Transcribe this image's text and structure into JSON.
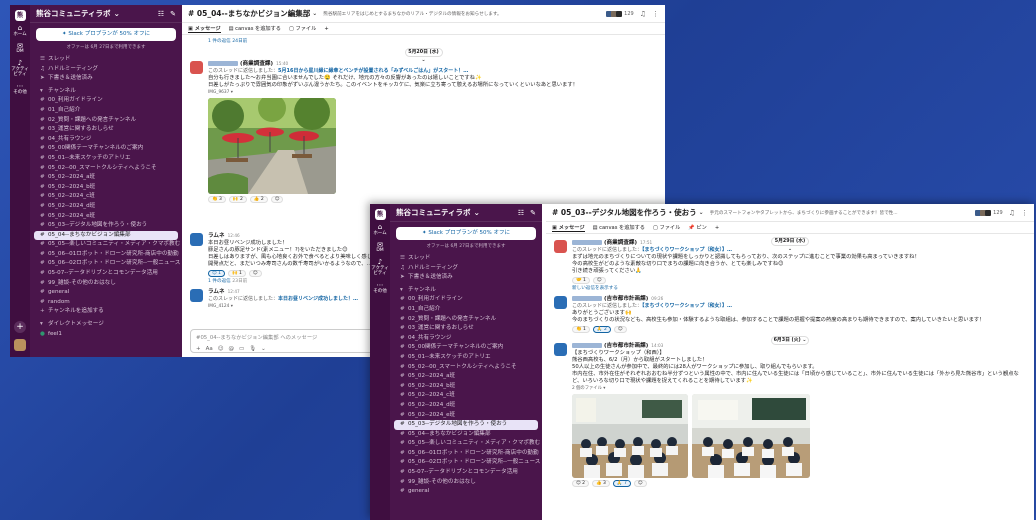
{
  "win1": {
    "rail": {
      "items": [
        {
          "icon": "home-icon",
          "label": "ホーム"
        },
        {
          "icon": "dm-icon",
          "label": "DM"
        },
        {
          "icon": "bell-icon",
          "label": "アクティビティ"
        },
        {
          "icon": "more-icon",
          "label": "その他"
        }
      ]
    },
    "sidebar": {
      "workspace": "熊谷コミュニティラボ",
      "promo": "✦ Slack プロプランが 50% オフに",
      "promo_note": "オファーは 6月 27日まで利用できます",
      "top_items": [
        "スレッド",
        "ハドルミーティング",
        "下書き＆送信済み"
      ],
      "section": "チャンネル",
      "channels": [
        "00_利用ガイドライン",
        "01_自己紹介",
        "02_質問・課題への発言チャンネル",
        "03_運営に関するおしらせ",
        "04_共有ラウンジ",
        "05_00関係テーマチャンネルのご案内",
        "05_01--未来スケッチのアトリエ",
        "05_02--00_スマートクルシティへようこそ",
        "05_02--2024_a班",
        "05_02--2024_b班",
        "05_02--2024_c班",
        "05_02--2024_d班",
        "05_02--2024_e班",
        "05_03--デジタル地図を作ろう・使おう",
        "05_04--まちなかビジョン編集部",
        "05_05--楽しいコミュニティ・メディア・クマポ教む",
        "05_06--01ロボット・ドローン研究所-商店中の勤勤",
        "05_06--02ロボット・ドローン研究所--一般ニュース",
        "05-07--データドリブンとコモンデータ活用",
        "99_雑談-その他のおはなし",
        "general",
        "random"
      ],
      "selected": "05_04--まちなかビジョン編集部",
      "add_channel": "チャンネルを追加する",
      "dm_section": "ダイレクトメッセージ",
      "dm_first": "feel1"
    },
    "header": {
      "title": "# 05_04--まちなかビジョン編集部",
      "topic": "熊谷駅前エリアをはじめとするまちなかのリアル・デジタルの情報をお知らせします。",
      "member_count": "129"
    },
    "tabs": [
      "メッセージ",
      "canvas を追加する",
      "ファイル",
      "+"
    ],
    "top_reply": "1 件の返信 24日前",
    "date_pill": "5月20日 (水) ⌄",
    "msg1": {
      "name": "(商業調査課)",
      "time": "15:40",
      "reply_prefix": "このスレッドに返信しました：",
      "reply_link": "5月16日から星川縁に縁傘とベンチが設置される「みずべルごはん」がスタート！…",
      "lines": [
        "自分も行きました〜お弁当園に合いませんでした🤤 それだけ、地元の方々の反響があったのは嬉しいことですね✨",
        "日差しがたっぷりで雰囲気の印象がずいぶん違うかたち。このイベントをキッカケに、気楽に立ち寄って憩えるお場所になっていくといいなあと思います！"
      ],
      "file": "IMG_9637 ▾",
      "reactions": [
        "👏 3",
        "🙌 2",
        "👍 2",
        "☺"
      ]
    },
    "msg2": {
      "name": "ラムネ",
      "time": "12:46",
      "lines": [
        "本日お昼リベンジ成功しました！",
        "豚足さんの豚足サンド(素メニュー！?)をいただきました😊",
        "日差しはありますが、風も心地良くお外で食べるとより美味しく感じました✨",
        "開発点だと、まだいつみ寿司さんの数千寿司がいかるようなので、…"
      ],
      "reactions": [
        "😊 1",
        "🙌 1",
        "☺"
      ],
      "thread": "1 件の返信",
      "thread_meta": "23日前"
    },
    "msg3": {
      "name": "ラムネ",
      "time": "12:47",
      "reply_prefix": "このスレッドに返信しました：",
      "reply_link": "本日お昼リベンジ成功しました！…",
      "file": "IMG_4124 ▾"
    },
    "composer": {
      "placeholder": "#05_04--まちなかビジョン編集部 へのメッセージ",
      "tools": [
        "+",
        "Aa",
        "☺",
        "@",
        "▭",
        "🎙",
        "⌄"
      ]
    }
  },
  "win2": {
    "sidebar": {
      "workspace": "熊谷コミュニティラボ",
      "promo": "✦ Slack プロプランが 50% オフに",
      "promo_note": "オファーは 6月 27日まで利用できます",
      "top_items": [
        "スレッド",
        "ハドルミーティング",
        "下書き＆送信済み"
      ],
      "section": "チャンネル",
      "channels": [
        "00_利用ガイドライン",
        "01_自己紹介",
        "02_質問・課題への発言チャンネル",
        "03_運営に関するおしらせ",
        "04_共有ラウンジ",
        "05_00関係テーマチャンネルのご案内",
        "05_01--未来スケッチのアトリエ",
        "05_02--00_スマートクルシティへようこそ",
        "05_02--2024_a班",
        "05_02--2024_b班",
        "05_02--2024_c班",
        "05_02--2024_d班",
        "05_02--2024_e班",
        "05_03--デジタル地図を作ろう・使おう",
        "05_04--まちなかビジョン編集部",
        "05_05--楽しいコミュニティ・メディア・クマポ教む",
        "05_06--01ロボット・ドローン研究所-商店中の勤勤",
        "05_06--02ロボット・ドローン研究所--一般ニュース",
        "05-07--データドリブンとコモンデータ活用",
        "99_雑談-その他のおはなし",
        "general"
      ],
      "selected": "05_03--デジタル地図を作ろう・使おう"
    },
    "header": {
      "title": "# 05_03--デジタル地図を作ろう・使おう",
      "topic": "手元のスマートフォンやタブレットから、まちづくりに参画することができます！皆で性...",
      "member_count": "129"
    },
    "tabs": [
      "メッセージ",
      "canvas を追加する",
      "ファイル",
      "ピン",
      "+"
    ],
    "date_pill1": "5月29日 (水) ⌄",
    "msg1": {
      "name": "(商業調査課)",
      "time": "17:51",
      "reply_prefix": "このスレッドに返信しました：",
      "reply_link": "【まちづくりワークショップ（和女）】…",
      "lines": [
        "まずは地元のまちづくりについての現状や課題をしっかりと認識してもらっており、次のステップに進むことで事業の効果も高まっていきますね！",
        "今の高校生がどのような素敵な切り口でまちの課題に向き合うか、とても楽しみですね😊",
        "引き続き頑張ってください🙏"
      ],
      "reactions": [
        "🤝 1",
        "☺"
      ],
      "new_reply": "新しい返信を表示する"
    },
    "msg2": {
      "name": "(吉市都市計画課)",
      "time": "09:26",
      "reply_prefix": "このスレッドに返信しました：",
      "reply_link": "【まちづくりワークショップ（和女）】…",
      "lines": [
        "ありがとうございます🙌",
        "今のまちづくりの状況なども、高校生も参加・体験するような取組は、参加することで課題の把握や提案の熱度の高まりも期待できますので、案内していきたいと思います！"
      ],
      "reactions": [
        "👏 1",
        "🙏 2",
        "☺"
      ]
    },
    "date_pill2": "6月3日 (火) ⌄",
    "msg3": {
      "name": "(吉市都市計画課)",
      "time": "14:03",
      "lines": [
        "【まちづくりワークショップ（和西）】",
        "熊谷西高校も、6/2（月）から取組がスタートしました！",
        "50人以上の生徒さんが参加中で、最終的には28人がワークショップに参加し、取り組んでもらいます。",
        "市内在住、市外在住がそれぞれおおむね半分ずつという属性の中で、市内に住んでいる生徒には「日頃から感じていること」、市外に住んでいる生徒には「外から見た熊谷市」という観点など、いろいろな切り口で現状や課題を捉えてくれることを期待しています✨"
      ],
      "files": "2 個のファイル ▾",
      "reactions": [
        "😊 2",
        "👍 3",
        "🙏 7",
        "☺"
      ]
    }
  },
  "colors": {
    "rail": "#3f0e40",
    "sidebar": "#4a154b",
    "link": "#1264a3",
    "background": "#2a4fb0"
  }
}
